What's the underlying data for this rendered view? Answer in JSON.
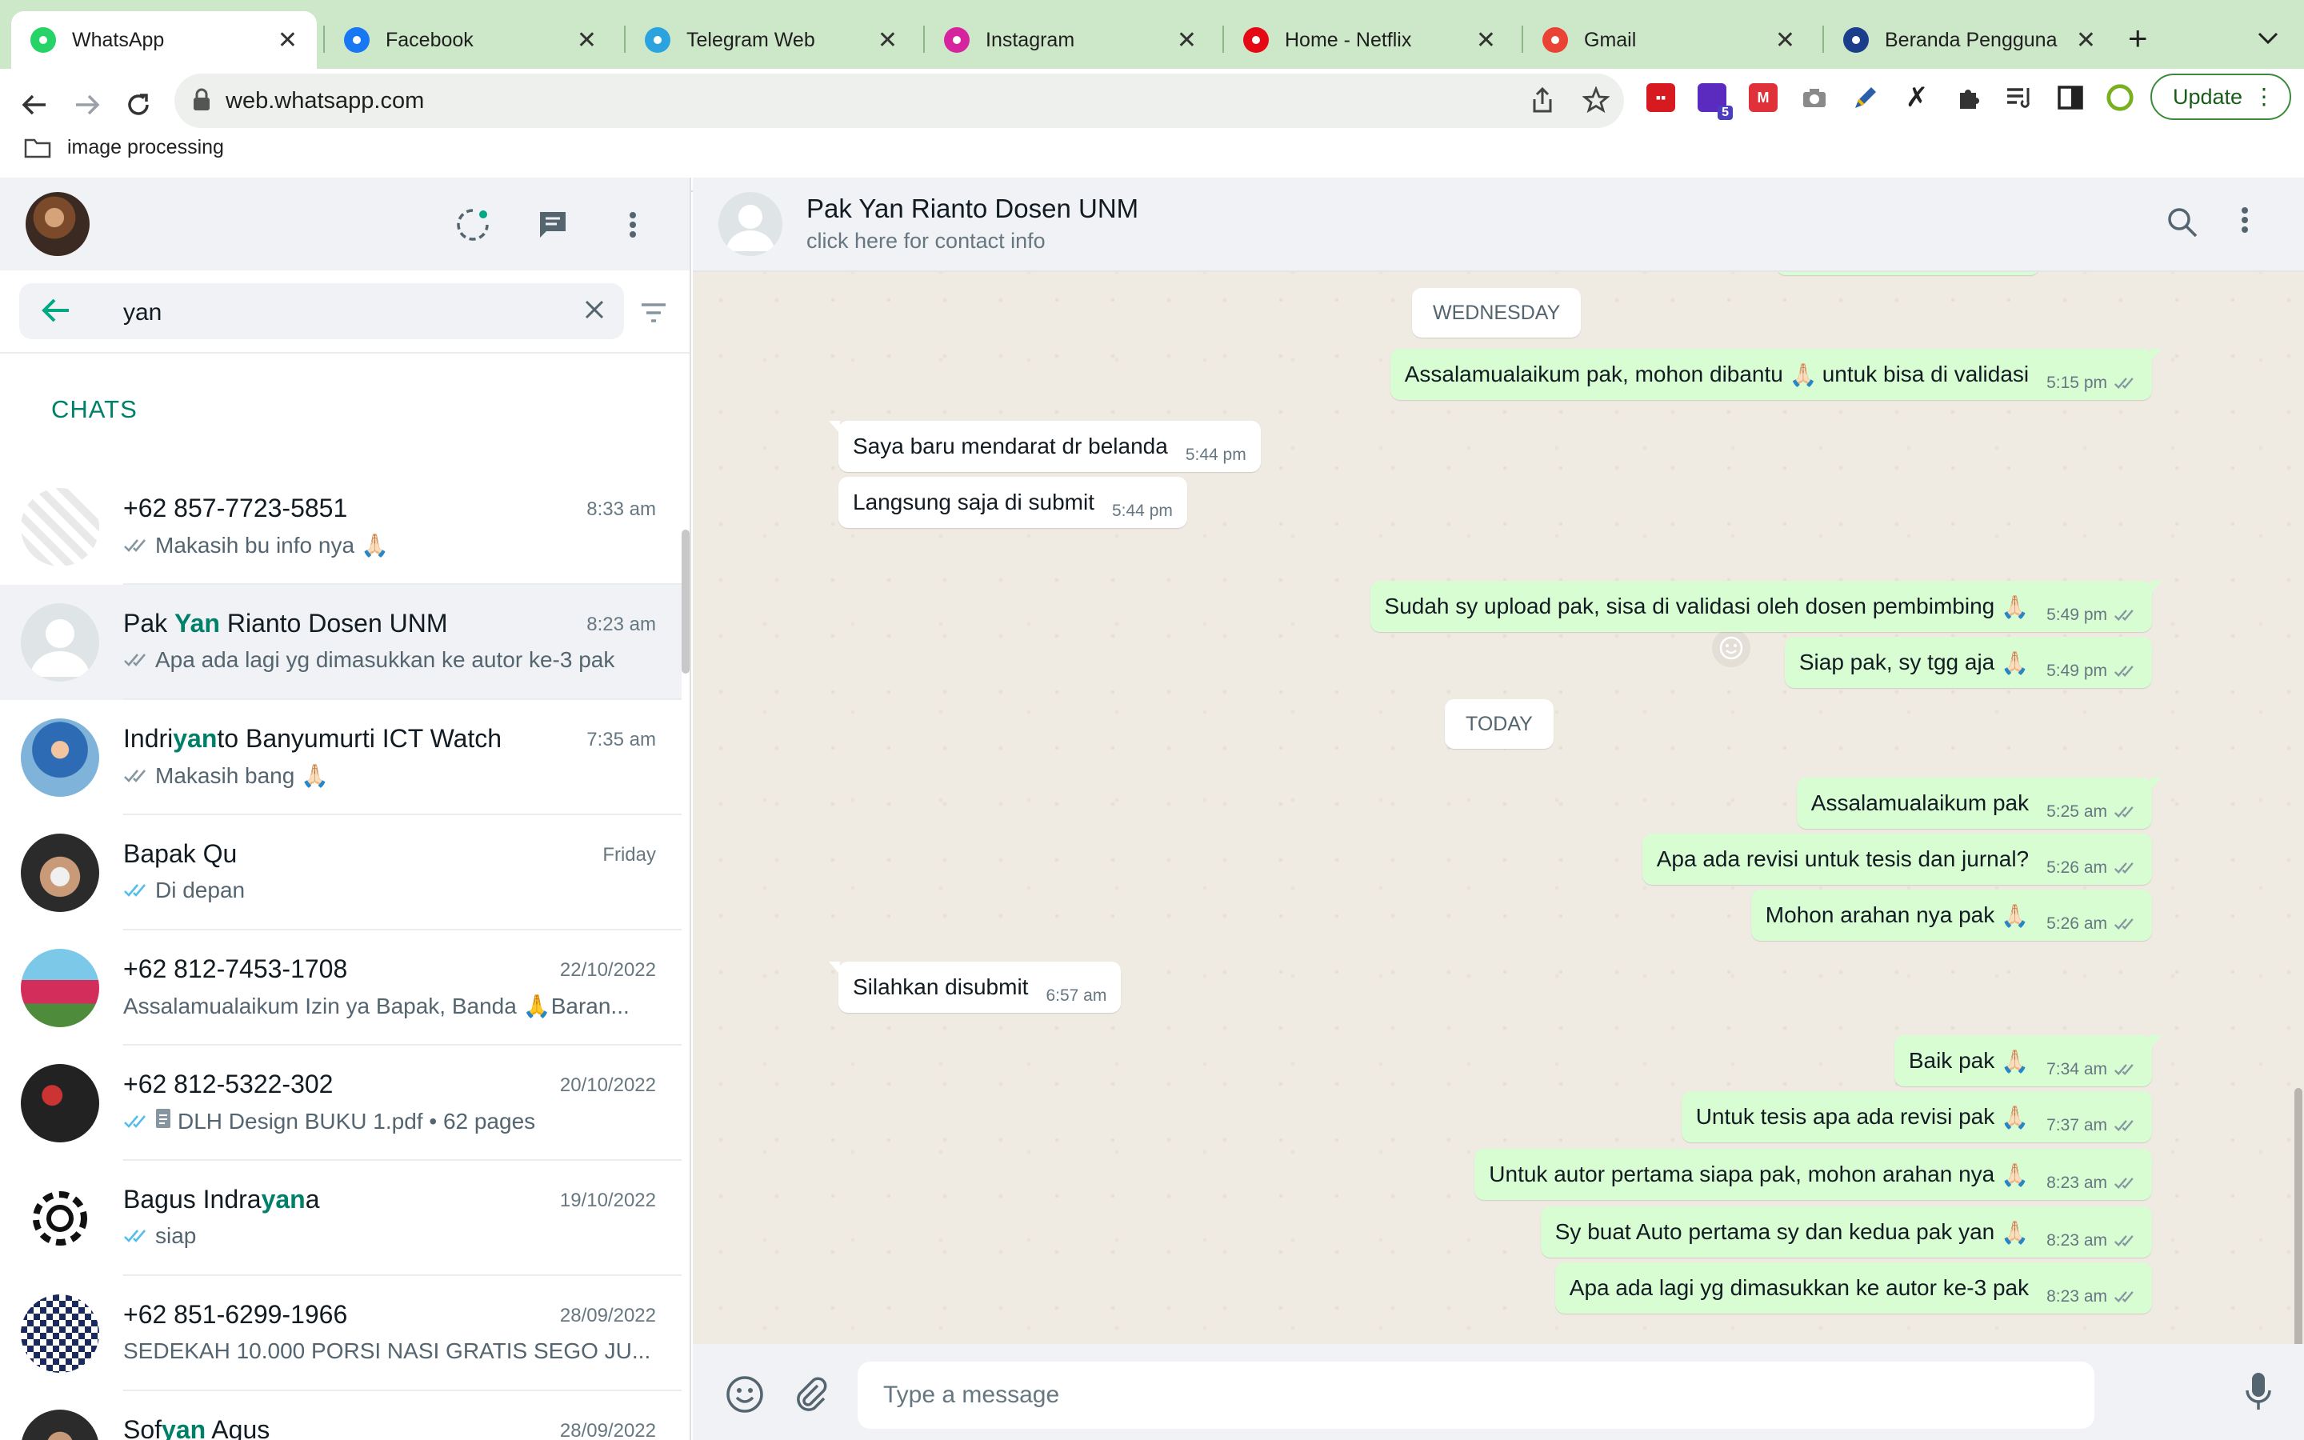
{
  "browser": {
    "tabs": [
      {
        "title": "WhatsApp",
        "icon": "whatsapp-icon",
        "color": "#25d366",
        "active": true
      },
      {
        "title": "Facebook",
        "icon": "facebook-icon",
        "color": "#1877f2"
      },
      {
        "title": "Telegram Web",
        "icon": "telegram-icon",
        "color": "#2aa3df"
      },
      {
        "title": "Instagram",
        "icon": "instagram-icon",
        "color": "#d6249f"
      },
      {
        "title": "Home - Netflix",
        "icon": "netflix-icon",
        "color": "#e50914"
      },
      {
        "title": "Gmail",
        "icon": "gmail-icon",
        "color": "#ea4335"
      },
      {
        "title": "Beranda Pengguna",
        "icon": "globe-icon",
        "color": "#1a3e8c"
      }
    ],
    "close_glyph": "✕",
    "new_tab_glyph": "+",
    "url": "web.whatsapp.com",
    "update_label": "Update",
    "bookmark": "image processing",
    "extension_badge": "5"
  },
  "sidebar": {
    "search_query": "yan",
    "section_label": "CHATS",
    "chats": [
      {
        "name_parts": [
          [
            "+62 857-7723-5851",
            false
          ]
        ],
        "time": "8:33 am",
        "tick": "read-grey",
        "preview": "Makasih bu info nya",
        "emoji": "🙏🏻",
        "avatar": "group"
      },
      {
        "name_parts": [
          [
            "Pak ",
            false
          ],
          [
            "Yan",
            true
          ],
          [
            " Rianto Dosen UNM",
            false
          ]
        ],
        "time": "8:23 am",
        "tick": "read-grey",
        "preview": "Apa ada lagi yg dimasukkan ke autor ke-3 pak",
        "emoji": "",
        "avatar": "default",
        "selected": true
      },
      {
        "name_parts": [
          [
            "Indri",
            false
          ],
          [
            "yan",
            true
          ],
          [
            "to Banyumurti ICT Watch",
            false
          ]
        ],
        "time": "7:35 am",
        "tick": "read-grey",
        "preview": "Makasih bang",
        "emoji": "🙏🏻",
        "avatar": "photo-blue"
      },
      {
        "name_parts": [
          [
            "Bapak Qu",
            false
          ]
        ],
        "time": "Friday",
        "tick": "read-blue",
        "preview": "Di depan",
        "emoji": "",
        "avatar": "photo-face"
      },
      {
        "name_parts": [
          [
            "+62 812-7453-1708",
            false
          ]
        ],
        "time": "22/10/2022",
        "tick": "",
        "preview": "Assalamualaikum Izin ya Bapak, Banda",
        "emoji": "🙏",
        "suffix": " Baran...",
        "avatar": "photo-red"
      },
      {
        "name_parts": [
          [
            "+62 812-5322-302",
            false
          ]
        ],
        "time": "20/10/2022",
        "tick": "read-blue",
        "preview": "DLH Design BUKU 1.pdf • 62 pages",
        "emoji": "",
        "doc": true,
        "avatar": "photo-dark"
      },
      {
        "name_parts": [
          [
            "Bagus Indra",
            false
          ],
          [
            "yan",
            true
          ],
          [
            "a",
            false
          ]
        ],
        "time": "19/10/2022",
        "tick": "read-blue",
        "preview": "siap",
        "emoji": "",
        "avatar": "gear"
      },
      {
        "name_parts": [
          [
            "+62 851-6299-1966",
            false
          ]
        ],
        "time": "28/09/2022",
        "tick": "",
        "preview": "SEDEKAH 10.000 PORSI NASI GRATIS SEGO JU...",
        "emoji": "",
        "avatar": "qr"
      },
      {
        "name_parts": [
          [
            "Sof",
            false
          ],
          [
            "yan",
            true
          ],
          [
            " Agus",
            false
          ]
        ],
        "time": "28/09/2022",
        "tick": "",
        "preview": "",
        "emoji": "",
        "avatar": "photo-face2"
      }
    ]
  },
  "conversation": {
    "contact_name": "Pak Yan Rianto Dosen UNM",
    "contact_sub": "click here for contact info",
    "composer_placeholder": "Type a message",
    "day_labels": {
      "wednesday": "WEDNESDAY",
      "today": "TODAY"
    },
    "messages": [
      {
        "dir": "out",
        "text": "Assalamualaikum pak, mohon dibantu",
        "emoji_mid": "🙏🏻",
        "text2": "untuk bisa di validasi",
        "time": "5:15 pm"
      },
      {
        "dir": "in",
        "text": "Saya baru mendarat dr belanda",
        "time": "5:44 pm"
      },
      {
        "dir": "in",
        "text": "Langsung saja di submit",
        "time": "5:44 pm"
      },
      {
        "dir": "out",
        "text": "Sudah sy upload pak, sisa di validasi oleh dosen pembimbing",
        "emoji": "🙏🏻",
        "time": "5:49 pm"
      },
      {
        "dir": "out",
        "text": "Siap pak, sy tgg aja",
        "emoji": "🙏🏻",
        "time": "5:49 pm"
      },
      {
        "dir": "out",
        "text": "Assalamualaikum pak",
        "time": "5:25 am"
      },
      {
        "dir": "out",
        "text": "Apa ada revisi untuk tesis dan jurnal?",
        "time": "5:26 am"
      },
      {
        "dir": "out",
        "text": "Mohon arahan nya pak",
        "emoji": "🙏🏻",
        "time": "5:26 am"
      },
      {
        "dir": "in",
        "text": "Silahkan disubmit",
        "time": "6:57 am"
      },
      {
        "dir": "out",
        "text": "Baik pak",
        "emoji": "🙏🏻",
        "time": "7:34 am"
      },
      {
        "dir": "out",
        "text": "Untuk tesis apa ada revisi pak",
        "emoji": "🙏🏻",
        "time": "7:37 am"
      },
      {
        "dir": "out",
        "text": "Untuk autor pertama siapa pak, mohon arahan nya",
        "emoji": "🙏🏻",
        "time": "8:23 am"
      },
      {
        "dir": "out",
        "text": "Sy buat Auto pertama sy dan kedua pak yan",
        "emoji": "🙏🏻",
        "time": "8:23 am"
      },
      {
        "dir": "out",
        "text": "Apa ada lagi yg dimasukkan ke autor ke-3 pak",
        "time": "8:23 am"
      }
    ]
  },
  "colors": {
    "accent": "#008069",
    "tick_blue": "#53bdeb",
    "tick_grey": "#8696a0",
    "bubble_out": "#d9fdd3",
    "tab_strip": "#cde8c8"
  }
}
